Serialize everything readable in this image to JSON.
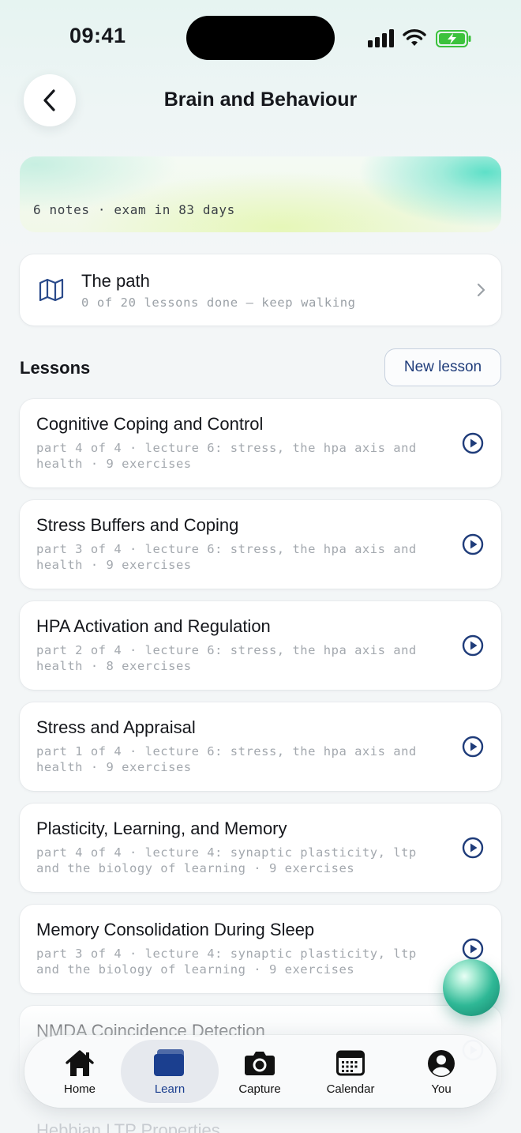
{
  "status_bar": {
    "time": "09:41"
  },
  "header": {
    "title": "Brain and Behaviour"
  },
  "banner": {
    "meta": "6 notes · exam in 83 days"
  },
  "path_card": {
    "title": "The path",
    "subtitle": "0 of 20 lessons done — keep walking"
  },
  "lessons_section": {
    "heading": "Lessons",
    "new_lesson_label": "New lesson",
    "items": [
      {
        "title": "Cognitive Coping and Control",
        "meta": "part 4 of 4 · lecture 6: stress, the hpa axis and health · 9 exercises"
      },
      {
        "title": "Stress Buffers and Coping",
        "meta": "part 3 of 4 · lecture 6: stress, the hpa axis and health · 9 exercises"
      },
      {
        "title": "HPA Activation and Regulation",
        "meta": "part 2 of 4 · lecture 6: stress, the hpa axis and health · 8 exercises"
      },
      {
        "title": "Stress and Appraisal",
        "meta": "part 1 of 4 · lecture 6: stress, the hpa axis and health · 9 exercises"
      },
      {
        "title": "Plasticity, Learning, and Memory",
        "meta": "part 4 of 4 · lecture 4: synaptic plasticity, ltp and the biology of learning · 9 exercises"
      },
      {
        "title": "Memory Consolidation During Sleep",
        "meta": "part 3 of 4 · lecture 4: synaptic plasticity, ltp and the biology of learning · 9 exercises"
      },
      {
        "title": "NMDA Coincidence Detection",
        "meta": ""
      },
      {
        "title": "Hebbian LTP Properties",
        "meta": ""
      }
    ]
  },
  "tabbar": {
    "tabs": [
      {
        "label": "Home",
        "icon": "home-icon"
      },
      {
        "label": "Learn",
        "icon": "cards-icon",
        "active": true
      },
      {
        "label": "Capture",
        "icon": "camera-icon"
      },
      {
        "label": "Calendar",
        "icon": "calendar-icon"
      },
      {
        "label": "You",
        "icon": "person-icon"
      }
    ]
  },
  "colors": {
    "accent": "#1f3c7a",
    "active_tab": "#1b3f8f",
    "orb": "#2fb896",
    "battery": "#3cc23c"
  }
}
